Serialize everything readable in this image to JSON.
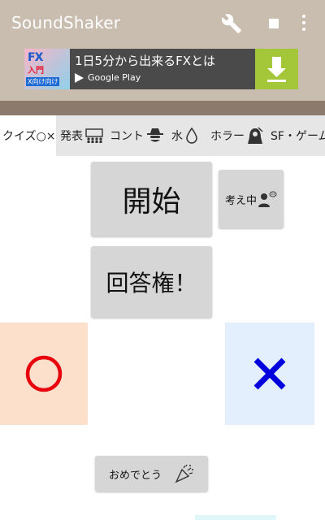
{
  "appbar": {
    "title": "SoundShaker",
    "bg_color": "#c9bdb0",
    "icons": [
      "wrench-icon",
      "stop-icon",
      "more-vert-icon"
    ]
  },
  "ad": {
    "thumb_text_1": "FX",
    "thumb_text_2": "入門",
    "thumb_text_3": "X向け向け",
    "text": "1日5分から出来るFXとは",
    "store": "Google Play",
    "download_color": "#a4c639"
  },
  "tabs": [
    {
      "label": "クイズ○×",
      "icon": "none"
    },
    {
      "label": "発表",
      "icon": "audience-icon"
    },
    {
      "label": "コント",
      "icon": "detective-icon"
    },
    {
      "label": "水",
      "icon": "water-drop-icon"
    },
    {
      "label": "ホラー",
      "icon": "reaper-icon"
    },
    {
      "label": "SF・ゲーム",
      "icon": "none"
    }
  ],
  "buttons": {
    "start": "開始",
    "thinking": "考え中",
    "answer_right": "回答権！",
    "congrats": "おめでとう"
  },
  "answers": {
    "correct_color": "#e8000d",
    "wrong_color": "#0000dd"
  }
}
